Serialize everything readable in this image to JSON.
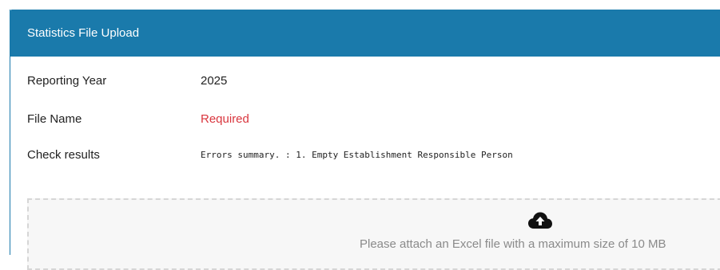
{
  "panel": {
    "title": "Statistics File Upload"
  },
  "fields": {
    "reporting_year": {
      "label": "Reporting Year",
      "value": "2025"
    },
    "file_name": {
      "label": "File Name",
      "value": "Required"
    },
    "check_results": {
      "label": "Check results",
      "value": "Errors summary. : 1. Empty Establishment Responsible Person"
    }
  },
  "dropzone": {
    "icon": "cloud-upload-icon",
    "hint": "Please attach an Excel file with a maximum size of 10 MB"
  },
  "colors": {
    "header_bg": "#1a7aab",
    "required": "#d9363e",
    "hint": "#8a8a8a"
  }
}
